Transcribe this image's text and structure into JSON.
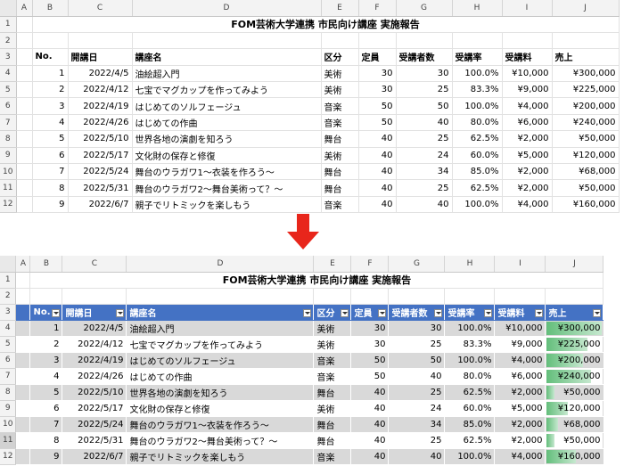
{
  "columns": [
    "A",
    "B",
    "C",
    "D",
    "E",
    "F",
    "G",
    "H",
    "I",
    "J"
  ],
  "title": "FOM芸術大学連携 市民向け講座 実施報告",
  "headers": [
    "No.",
    "開講日",
    "講座名",
    "区分",
    "定員",
    "受講者数",
    "受講率",
    "受講料",
    "売上"
  ],
  "rows": [
    {
      "no": "1",
      "date": "2022/4/5",
      "name": "油絵超入門",
      "cat": "美術",
      "cap": "30",
      "att": "30",
      "rate": "100.0%",
      "fee": "¥10,000",
      "sales": "¥300,000",
      "sales_val": 300000
    },
    {
      "no": "2",
      "date": "2022/4/12",
      "name": "七宝でマグカップを作ってみよう",
      "cat": "美術",
      "cap": "30",
      "att": "25",
      "rate": "83.3%",
      "fee": "¥9,000",
      "sales": "¥225,000",
      "sales_val": 225000
    },
    {
      "no": "3",
      "date": "2022/4/19",
      "name": "はじめてのソルフェージュ",
      "cat": "音楽",
      "cap": "50",
      "att": "50",
      "rate": "100.0%",
      "fee": "¥4,000",
      "sales": "¥200,000",
      "sales_val": 200000
    },
    {
      "no": "4",
      "date": "2022/4/26",
      "name": "はじめての作曲",
      "cat": "音楽",
      "cap": "50",
      "att": "40",
      "rate": "80.0%",
      "fee": "¥6,000",
      "sales": "¥240,000",
      "sales_val": 240000
    },
    {
      "no": "5",
      "date": "2022/5/10",
      "name": "世界各地の演劇を知ろう",
      "cat": "舞台",
      "cap": "40",
      "att": "25",
      "rate": "62.5%",
      "fee": "¥2,000",
      "sales": "¥50,000",
      "sales_val": 50000
    },
    {
      "no": "6",
      "date": "2022/5/17",
      "name": "文化財の保存と修復",
      "cat": "美術",
      "cap": "40",
      "att": "24",
      "rate": "60.0%",
      "fee": "¥5,000",
      "sales": "¥120,000",
      "sales_val": 120000
    },
    {
      "no": "7",
      "date": "2022/5/24",
      "name": "舞台のウラガワ1～衣装を作ろう～",
      "cat": "舞台",
      "cap": "40",
      "att": "34",
      "rate": "85.0%",
      "fee": "¥2,000",
      "sales": "¥68,000",
      "sales_val": 68000
    },
    {
      "no": "8",
      "date": "2022/5/31",
      "name": "舞台のウラガワ2～舞台美術って？～",
      "cat": "舞台",
      "cap": "40",
      "att": "25",
      "rate": "62.5%",
      "fee": "¥2,000",
      "sales": "¥50,000",
      "sales_val": 50000
    },
    {
      "no": "9",
      "date": "2022/6/7",
      "name": "親子でリトミックを楽しもう",
      "cat": "音楽",
      "cap": "40",
      "att": "40",
      "rate": "100.0%",
      "fee": "¥4,000",
      "sales": "¥160,000",
      "sales_val": 160000
    }
  ],
  "colors": {
    "header_fill": "#4472c4",
    "band_fill": "#d9d9d9",
    "bar_fill": "#63be7b",
    "arrow": "#e8261b"
  },
  "arrow_icon": "arrow-down-icon"
}
